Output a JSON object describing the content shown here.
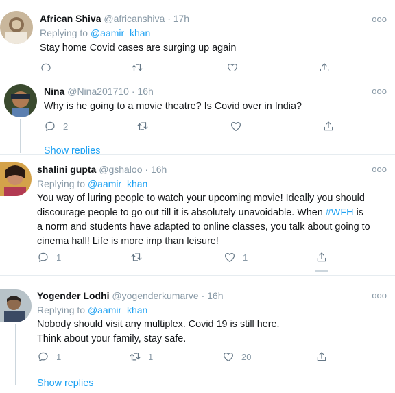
{
  "tweets": [
    {
      "name": "African Shiva",
      "handle": "@africanshiva",
      "time": "· 17h",
      "replying_prefix": "Replying to",
      "replying_to": "@aamir_khan",
      "text": "Stay home Covid cases are surging up again",
      "counts": {
        "reply": "",
        "retweet": "",
        "like": ""
      }
    },
    {
      "name": "Nina",
      "handle": "@Nina201710",
      "time": "· 16h",
      "text": "Why is he going to a movie theatre?  Is Covid over in India?",
      "counts": {
        "reply": "2",
        "retweet": "",
        "like": ""
      },
      "show_replies": "Show replies"
    },
    {
      "name": "shalini gupta",
      "handle": "@gshaloo",
      "time": "· 16h",
      "replying_prefix": "Replying to",
      "replying_to": "@aamir_khan",
      "text_lines": [
        "You way of luring people to watch your upcoming movie! Ideally you should",
        "discourage people to go out till it is absolutely unavoidable. When ",
        "a norm and students have adapted to online classes, you talk about going to",
        "cinema hall! Life is more imp than leisure!"
      ],
      "hashtag": "#WFH",
      "hashtag_after": " is",
      "counts": {
        "reply": "1",
        "retweet": "",
        "like": "1"
      }
    },
    {
      "name": "Yogender Lodhi",
      "handle": "@yogenderkumarve",
      "time": "· 16h",
      "replying_prefix": "Replying to",
      "replying_to": "@aamir_khan",
      "text_lines": [
        "Nobody should visit any multiplex. Covid 19 is still here.",
        "Think about your family, stay safe."
      ],
      "counts": {
        "reply": "1",
        "retweet": "1",
        "like": "20"
      },
      "show_replies": "Show replies"
    }
  ],
  "more_glyph": "ooo",
  "colors": {
    "accent": "#1da1f2",
    "muted": "#8899a6",
    "divider": "#e6ecf0"
  },
  "icons": [
    "reply-icon",
    "retweet-icon",
    "like-icon",
    "share-icon",
    "more-icon"
  ]
}
